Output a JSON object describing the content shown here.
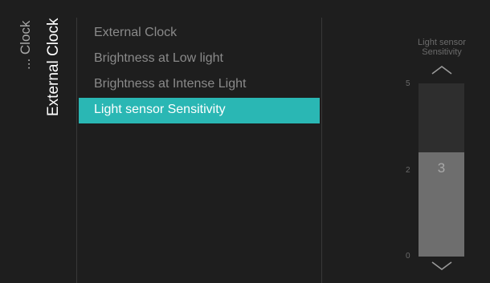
{
  "breadcrumb": {
    "parent": "... Clock",
    "current": "External Clock"
  },
  "menu": {
    "items": [
      {
        "label": "External Clock",
        "selected": false
      },
      {
        "label": "Brightness at Low light",
        "selected": false
      },
      {
        "label": "Brightness at Intense Light",
        "selected": false
      },
      {
        "label": "Light sensor Sensitivity",
        "selected": true
      }
    ]
  },
  "slider": {
    "title_line1": "Light sensor",
    "title_line2": "Sensitivity",
    "value": 3,
    "value_label": "3",
    "min": 0,
    "max": 5,
    "ticks": {
      "top": "5",
      "mid": "2",
      "bottom": "0"
    },
    "up_icon": "chevron-up-icon",
    "down_icon": "chevron-down-icon"
  },
  "colors": {
    "accent": "#2ab7b4",
    "background": "#1e1e1e",
    "track": "#2e2e2e",
    "fill": "#6e6e6e"
  }
}
